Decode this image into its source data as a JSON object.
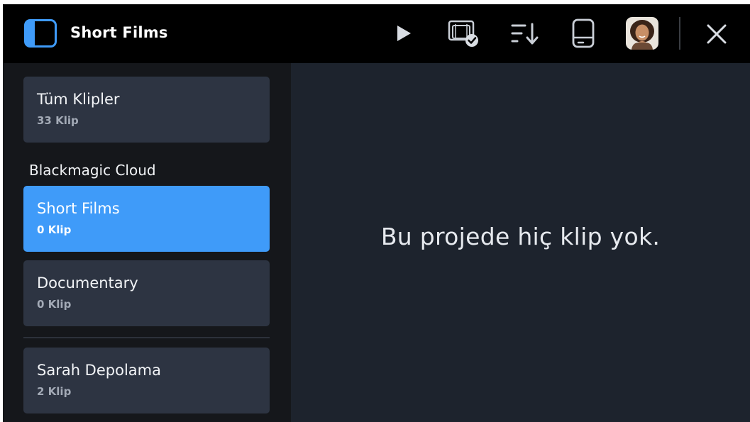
{
  "header": {
    "title": "Short Films",
    "icons": [
      "sidebar-toggle-icon",
      "play-icon",
      "clip-check-icon",
      "sort-icon",
      "drive-icon",
      "avatar",
      "close-icon"
    ]
  },
  "sidebar": {
    "all_clips": {
      "label": "Tüm Klipler",
      "count": "33 Klip"
    },
    "section_title": "Blackmagic Cloud",
    "projects": [
      {
        "label": "Short Films",
        "count": "0 Klip",
        "selected": true
      },
      {
        "label": "Documentary",
        "count": "0 Klip",
        "selected": false
      }
    ],
    "storage": {
      "label": "Sarah Depolama",
      "count": "2 Klip"
    }
  },
  "main": {
    "empty_message": "Bu projede hiç klip yok."
  },
  "colors": {
    "topbar": "#000000",
    "sidebar_bg": "#15171b",
    "main_bg": "#1d232d",
    "card_bg": "#2d3442",
    "accent": "#3f9bf9"
  }
}
